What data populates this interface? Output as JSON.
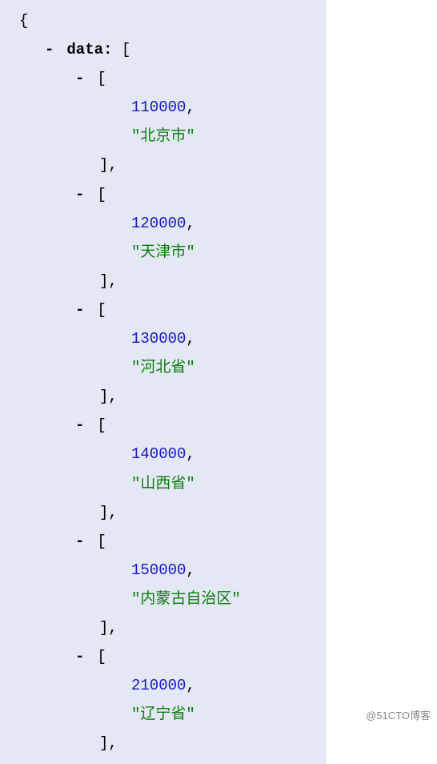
{
  "root_key": "data:",
  "items": [
    {
      "code": 110000,
      "name": "北京市"
    },
    {
      "code": 120000,
      "name": "天津市"
    },
    {
      "code": 130000,
      "name": "河北省"
    },
    {
      "code": 140000,
      "name": "山西省"
    },
    {
      "code": 150000,
      "name": "内蒙古自治区"
    },
    {
      "code": 210000,
      "name": "辽宁省"
    }
  ],
  "symbols": {
    "open_brace": "{",
    "open_bracket": "[",
    "close_bracket_comma": "],",
    "dash": "-",
    "comma": ",",
    "quote": "\""
  },
  "watermark": "@51CTO博客"
}
